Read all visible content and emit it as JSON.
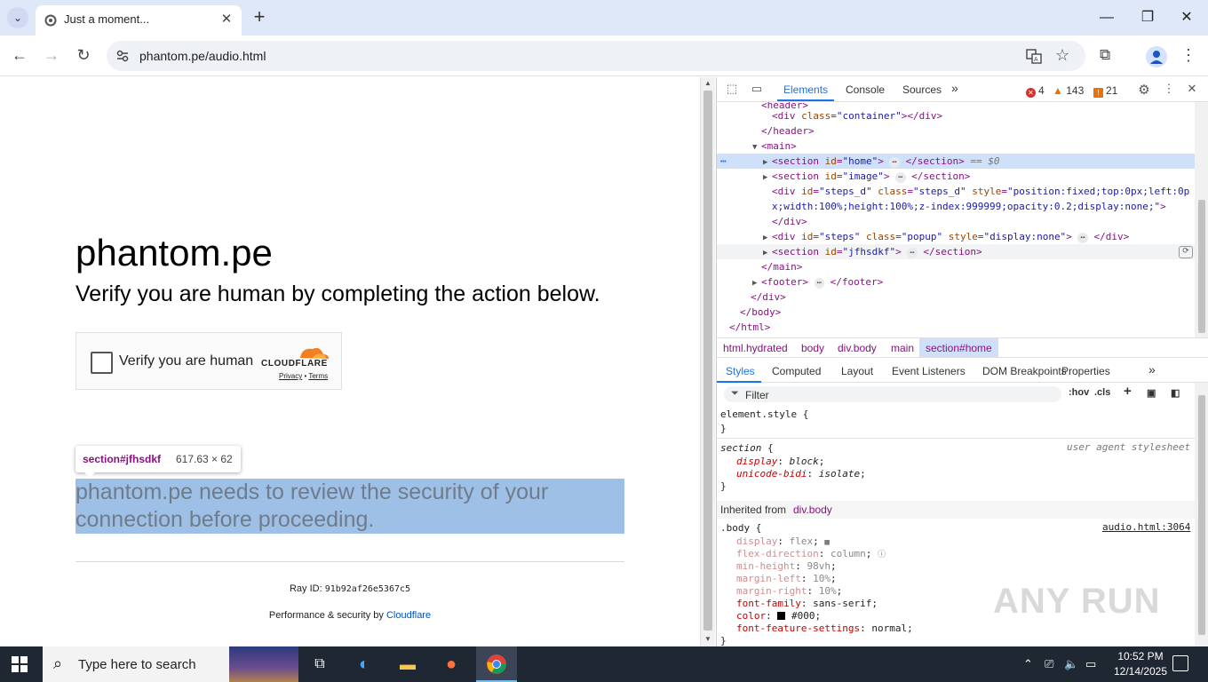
{
  "browser": {
    "tab_title": "Just a moment...",
    "url": "phantom.pe/audio.html"
  },
  "page": {
    "site_title": "phantom.pe",
    "subtitle": "Verify you are human by completing the action below.",
    "cf_label": "Verify you are human",
    "cf_brand": "CLOUDFLARE",
    "cf_privacy": "Privacy",
    "cf_dot": " • ",
    "cf_terms": "Terms",
    "tooltip_selector": "section#jfhsdkf",
    "tooltip_size": "617.63 × 62",
    "review_text": "phantom.pe needs to review the security of your connection before proceeding.",
    "ray_label": "Ray ID: ",
    "ray_value": "91b92af26e5367c5",
    "perf_label": "Performance & security by ",
    "perf_link": "Cloudflare"
  },
  "devtools": {
    "tabs": [
      "Elements",
      "Console",
      "Sources"
    ],
    "errors": "4",
    "warnings": "143",
    "issues": "21",
    "breadcrumbs": [
      "html.hydrated",
      "body",
      "div.body",
      "main",
      "section#home"
    ],
    "style_tabs": [
      "Styles",
      "Computed",
      "Layout",
      "Event Listeners",
      "DOM Breakpoints",
      "Properties"
    ],
    "filter_placeholder": "Filter",
    "hov": ":hov",
    "cls": ".cls",
    "inherited_label": "Inherited from ",
    "inherited_from": "div.body",
    "ua_origin": "user agent stylesheet",
    "body_origin": "audio.html:3064"
  },
  "taskbar": {
    "search_placeholder": "Type here to search",
    "time": "10:52 PM",
    "date": "12/14/2025"
  },
  "watermark": "ANY RUN"
}
